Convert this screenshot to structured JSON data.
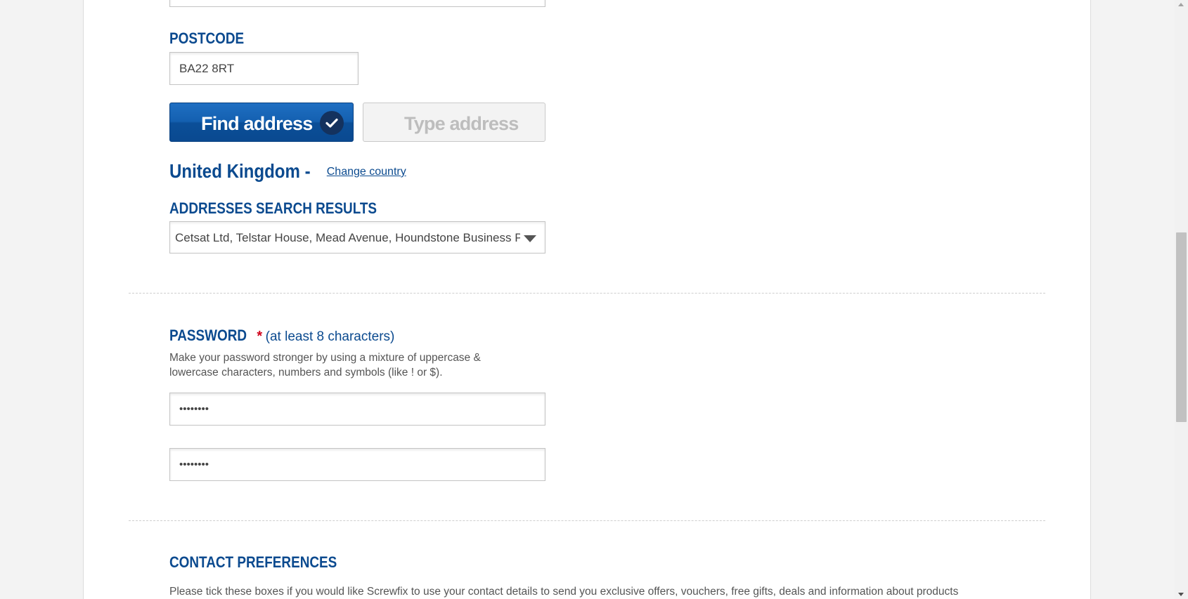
{
  "postcode": {
    "label": "POSTCODE",
    "value": "BA22 8RT"
  },
  "buttons": {
    "find_address": "Find address",
    "type_address": "Type address"
  },
  "country": {
    "name": "United Kingdom -",
    "change_link": "Change country"
  },
  "address_results": {
    "label": "ADDRESSES SEARCH RESULTS",
    "selected": "Cetsat Ltd, Telstar House, Mead Avenue, Houndstone Business Park"
  },
  "password": {
    "label": "PASSWORD",
    "required_mark": "*",
    "hint": "(at least 8 characters)",
    "help_line1": "Make your password stronger by using a mixture of uppercase &",
    "help_line2": "lowercase characters, numbers and symbols (like ! or $).",
    "value": "••••••••",
    "confirm_value": "••••••••"
  },
  "contact": {
    "heading": "CONTACT PREFERENCES",
    "text": "Please tick these boxes if you would like Screwfix to use your contact details to send you exclusive offers, vouchers, free gifts, deals and information about products"
  },
  "colors": {
    "brand_blue": "#0b4a8f",
    "required_red": "#d0021b",
    "button_blue": "#1460b0"
  }
}
